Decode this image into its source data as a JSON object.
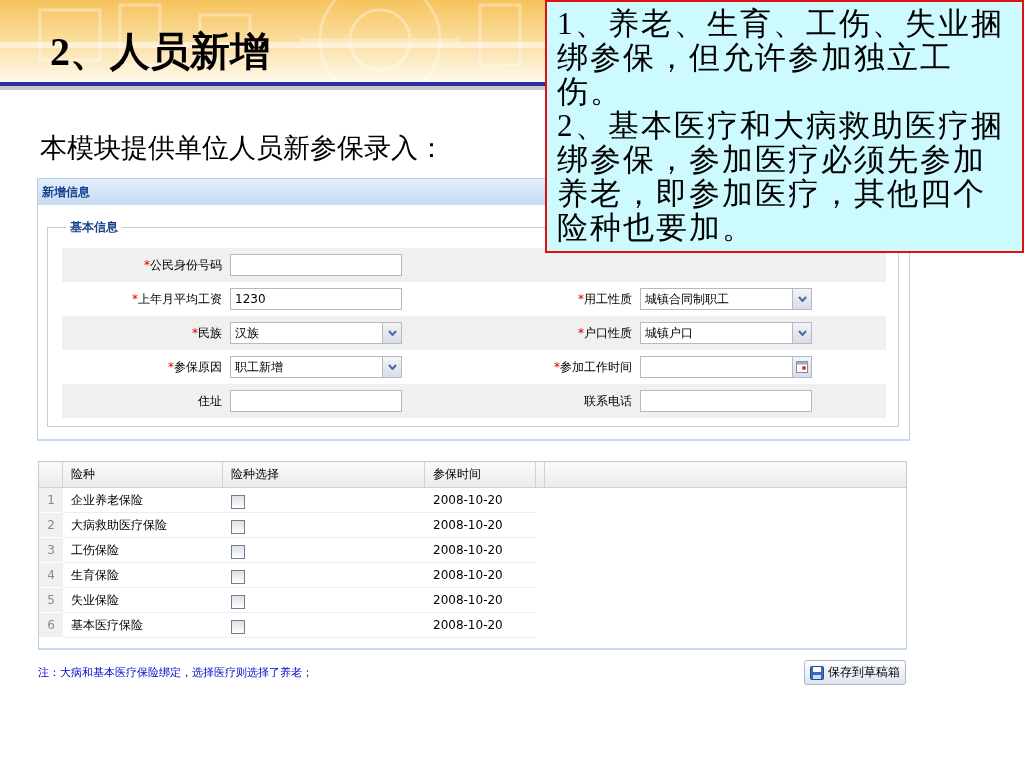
{
  "slide_title": "2、人员新增",
  "intro": "本模块提供单位人员新参保录入：",
  "callout": [
    "1、养老、生育、工伤、失业捆绑参保，但允许参加独立工伤。",
    "2、基本医疗和大病救助医疗捆绑参保，参加医疗必须先参加养老，即参加医疗，其他四个险种也要加。"
  ],
  "panel": {
    "title": "新增信息",
    "fieldset": {
      "legend": "基本信息",
      "rows": [
        {
          "left": {
            "mark": "*",
            "label": "公民身份号码",
            "kind": "text"
          }
        },
        {
          "left": {
            "mark": "*",
            "label": "上年月平均工资",
            "kind": "text",
            "value": "1230"
          },
          "right": {
            "mark": "*",
            "label": "用工性质",
            "kind": "select",
            "value": "城镇合同制职工"
          }
        },
        {
          "left": {
            "mark": "*",
            "label": "民族",
            "kind": "select",
            "value": "汉族"
          },
          "right": {
            "mark": "*",
            "label": "户口性质",
            "kind": "select",
            "value": "城镇户口"
          }
        },
        {
          "left": {
            "mark": "*",
            "label": "参保原因",
            "kind": "select",
            "value": "职工新增"
          },
          "right": {
            "mark": "*",
            "label": "参加工作时间",
            "kind": "date"
          }
        },
        {
          "left": {
            "label": "住址",
            "kind": "text"
          },
          "right": {
            "label": "联系电话",
            "kind": "text"
          }
        }
      ]
    }
  },
  "table": {
    "columns": [
      "险种",
      "险种选择",
      "参保时间"
    ],
    "rows": [
      {
        "index": "1",
        "name": "企业养老保险",
        "checked": false,
        "date": "2008-10-20"
      },
      {
        "index": "2",
        "name": "大病救助医疗保险",
        "checked": false,
        "date": "2008-10-20"
      },
      {
        "index": "3",
        "name": "工伤保险",
        "checked": false,
        "date": "2008-10-20"
      },
      {
        "index": "4",
        "name": "生育保险",
        "checked": false,
        "date": "2008-10-20"
      },
      {
        "index": "5",
        "name": "失业保险",
        "checked": false,
        "date": "2008-10-20"
      },
      {
        "index": "6",
        "name": "基本医疗保险",
        "checked": false,
        "date": "2008-10-20"
      }
    ]
  },
  "note": "注：大病和基本医疗保险绑定，选择医疗则选择了养老；",
  "save_button": "保存到草稿箱"
}
